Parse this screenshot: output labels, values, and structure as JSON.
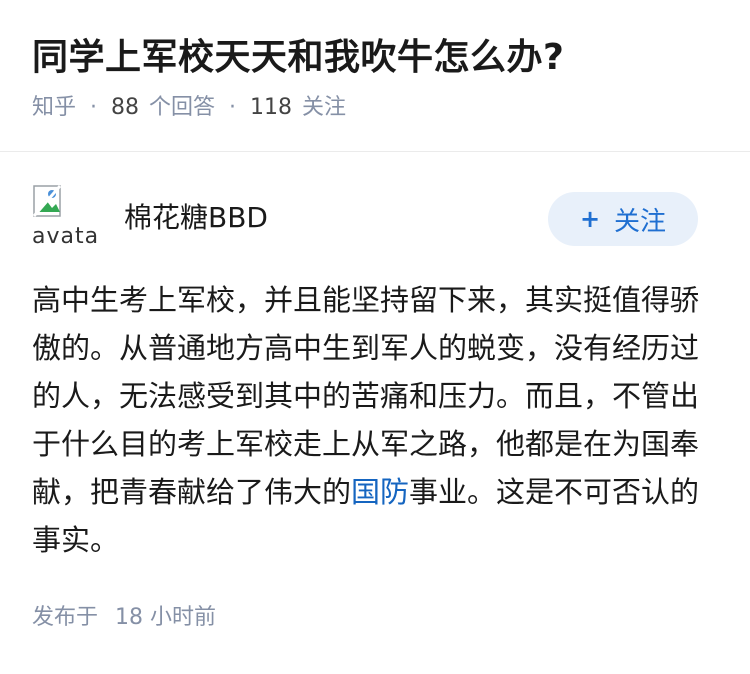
{
  "question": {
    "title": "同学上军校天天和我吹牛怎么办?",
    "source": "知乎",
    "answer_count": "88",
    "answer_label": "个回答",
    "follow_count": "118",
    "follow_label": "关注"
  },
  "answer": {
    "author": {
      "avatar_alt": "avatar",
      "name": "棉花糖BBD",
      "follow_button_label": "关注",
      "follow_button_icon": "plus-icon"
    },
    "content": {
      "text_before_link": "高中生考上军校，并且能坚持留下来，其实挺值得骄傲的。从普通地方高中生到军人的蜕变，没有经历过的人，无法感受到其中的苦痛和压力。而且，不管出于什么目的考上军校走上从军之路，他都是在为国奉献，把青春献给了伟大的",
      "link_text": "国防",
      "text_after_link": "事业。这是不可否认的事实。"
    },
    "footer": {
      "published_label": "发布于",
      "time_value": "18",
      "time_unit": "小时前"
    }
  },
  "colors": {
    "meta_gray": "#8590a6",
    "link_blue": "#1565c0",
    "follow_button_bg": "#e8f0fa",
    "follow_button_text": "#1f6fd1"
  }
}
